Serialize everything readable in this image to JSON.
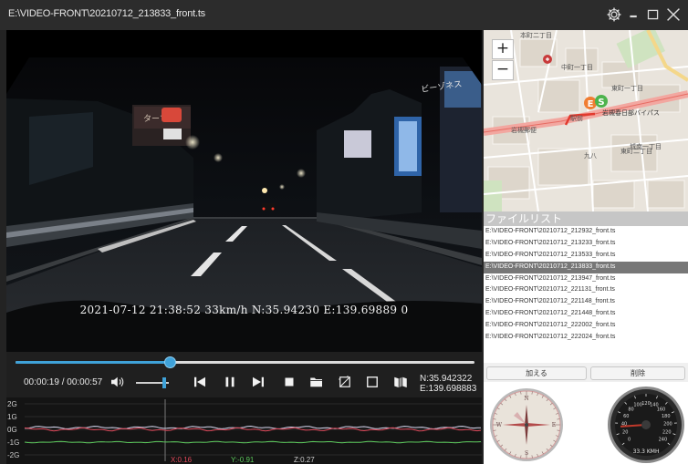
{
  "window": {
    "title": "E:\\VIDEO-FRONT\\20210712_213833_front.ts"
  },
  "video": {
    "overlay_text": "2021-07-12 21:38:52 33km/h N:35.94230 E:139.69889 0"
  },
  "player": {
    "time_display": "00:00:19 / 00:00:57",
    "progress_fraction": 0.335,
    "volume_fraction": 0.85,
    "gps_lat": "N:35.942322",
    "gps_lon": "E:139.698883"
  },
  "gsensor": {
    "y_labels": [
      "2G",
      "1G",
      "0G",
      "-1G",
      "-2G"
    ],
    "x_value": "X:0.16",
    "y_value": "Y:-0.91",
    "z_value": "Z:0.27",
    "colors": {
      "x": "#e0485a",
      "y": "#5cc85c",
      "z": "#d8d8f0"
    }
  },
  "map": {
    "zoom_in_label": "+",
    "zoom_out_label": "−",
    "marker_start": "S",
    "marker_end": "E",
    "labels": [
      "本町二丁目",
      "中町一丁目",
      "東町一丁目",
      "東町二丁目",
      "岩槻春日部バイパス",
      "岩槻郵便",
      "駅前",
      "城南一丁目",
      "九八"
    ]
  },
  "playlist": {
    "header": "ファイルリスト",
    "selected_index": 3,
    "items": [
      "E:\\VIDEO-FRONT\\20210712_212932_front.ts",
      "E:\\VIDEO-FRONT\\20210712_213233_front.ts",
      "E:\\VIDEO-FRONT\\20210712_213533_front.ts",
      "E:\\VIDEO-FRONT\\20210712_213833_front.ts",
      "E:\\VIDEO-FRONT\\20210712_213947_front.ts",
      "E:\\VIDEO-FRONT\\20210712_221131_front.ts",
      "E:\\VIDEO-FRONT\\20210712_221148_front.ts",
      "E:\\VIDEO-FRONT\\20210712_221448_front.ts",
      "E:\\VIDEO-FRONT\\20210712_222002_front.ts",
      "E:\\VIDEO-FRONT\\20210712_222024_front.ts"
    ],
    "add_label": "加える",
    "delete_label": "削除"
  },
  "gauges": {
    "compass_labels": [
      "N",
      "E",
      "S",
      "W"
    ],
    "speed_ticks": [
      "0",
      "20",
      "40",
      "60",
      "80",
      "100",
      "120",
      "140",
      "160",
      "180",
      "200",
      "220",
      "240"
    ],
    "speed_value_kmh": 33.3,
    "speed_text": "33.3 KMH",
    "speed_max": 240
  }
}
